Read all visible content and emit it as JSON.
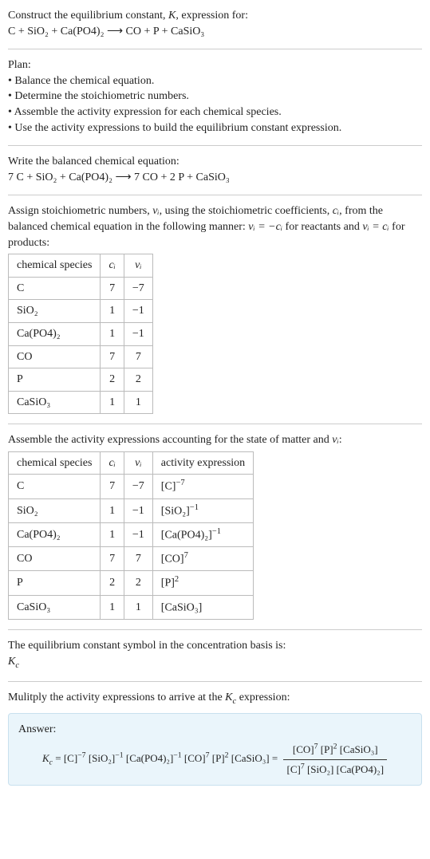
{
  "prompt": {
    "line1": "Construct the equilibrium constant, K, expression for:",
    "equation": "C + SiO₂ + Ca(PO4)₂  ⟶  CO + P + CaSiO₃"
  },
  "plan": {
    "heading": "Plan:",
    "items": [
      "• Balance the chemical equation.",
      "• Determine the stoichiometric numbers.",
      "• Assemble the activity expression for each chemical species.",
      "• Use the activity expressions to build the equilibrium constant expression."
    ]
  },
  "balanced": {
    "heading": "Write the balanced chemical equation:",
    "equation": "7 C + SiO₂ + Ca(PO4)₂  ⟶  7 CO + 2 P + CaSiO₃"
  },
  "stoich": {
    "intro_a": "Assign stoichiometric numbers, ",
    "intro_b": ", using the stoichiometric coefficients, ",
    "intro_c": ", from the balanced chemical equation in the following manner: ",
    "intro_d": " for reactants and ",
    "intro_e": " for products:",
    "nu_label": "νᵢ",
    "c_label": "cᵢ",
    "rel_react": "νᵢ = −cᵢ",
    "rel_prod": "νᵢ = cᵢ",
    "headers": [
      "chemical species",
      "cᵢ",
      "νᵢ"
    ],
    "rows": [
      {
        "sp": "C",
        "c": "7",
        "v": "−7"
      },
      {
        "sp": "SiO₂",
        "c": "1",
        "v": "−1"
      },
      {
        "sp": "Ca(PO4)₂",
        "c": "1",
        "v": "−1"
      },
      {
        "sp": "CO",
        "c": "7",
        "v": "7"
      },
      {
        "sp": "P",
        "c": "2",
        "v": "2"
      },
      {
        "sp": "CaSiO₃",
        "c": "1",
        "v": "1"
      }
    ]
  },
  "activity": {
    "intro_a": "Assemble the activity expressions accounting for the state of matter and ",
    "intro_b": ":",
    "headers": [
      "chemical species",
      "cᵢ",
      "νᵢ",
      "activity expression"
    ],
    "rows": [
      {
        "sp": "C",
        "c": "7",
        "v": "−7",
        "act_base": "[C]",
        "act_exp": "−7"
      },
      {
        "sp": "SiO₂",
        "c": "1",
        "v": "−1",
        "act_base": "[SiO₂]",
        "act_exp": "−1"
      },
      {
        "sp": "Ca(PO4)₂",
        "c": "1",
        "v": "−1",
        "act_base": "[Ca(PO4)₂]",
        "act_exp": "−1"
      },
      {
        "sp": "CO",
        "c": "7",
        "v": "7",
        "act_base": "[CO]",
        "act_exp": "7"
      },
      {
        "sp": "P",
        "c": "2",
        "v": "2",
        "act_base": "[P]",
        "act_exp": "2"
      },
      {
        "sp": "CaSiO₃",
        "c": "1",
        "v": "1",
        "act_base": "[CaSiO₃]",
        "act_exp": ""
      }
    ]
  },
  "symbol": {
    "line": "The equilibrium constant symbol in the concentration basis is:",
    "kc_base": "K",
    "kc_sub": "c"
  },
  "multiply": "Mulitply the activity expressions to arrive at the Kc expression:",
  "answer": {
    "label": "Answer:",
    "lhs": "Kc = ",
    "terms": [
      {
        "base": "[C]",
        "exp": "−7"
      },
      {
        "base": "[SiO₂]",
        "exp": "−1"
      },
      {
        "base": "[Ca(PO4)₂]",
        "exp": "−1"
      },
      {
        "base": "[CO]",
        "exp": "7"
      },
      {
        "base": "[P]",
        "exp": "2"
      },
      {
        "base": "[CaSiO₃]",
        "exp": ""
      }
    ],
    "eq": " = ",
    "num": [
      {
        "base": "[CO]",
        "exp": "7"
      },
      {
        "base": "[P]",
        "exp": "2"
      },
      {
        "base": "[CaSiO₃]",
        "exp": ""
      }
    ],
    "den": [
      {
        "base": "[C]",
        "exp": "7"
      },
      {
        "base": "[SiO₂]",
        "exp": ""
      },
      {
        "base": "[Ca(PO4)₂]",
        "exp": ""
      }
    ]
  }
}
